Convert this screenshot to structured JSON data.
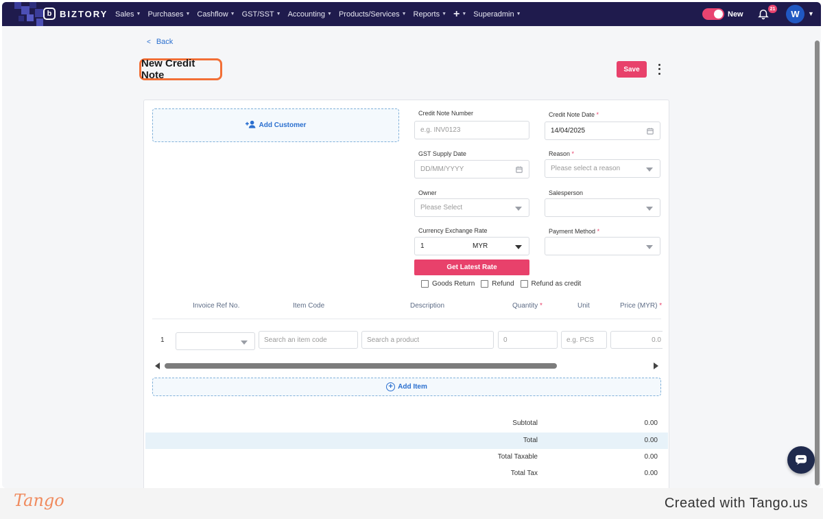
{
  "nav": {
    "brand": "BIZTORY",
    "brand_icon": "b",
    "menu": [
      {
        "label": "Sales"
      },
      {
        "label": "Purchases"
      },
      {
        "label": "Cashflow"
      },
      {
        "label": "GST/SST"
      },
      {
        "label": "Accounting"
      },
      {
        "label": "Products/Services"
      },
      {
        "label": "Reports"
      },
      {
        "label": "+"
      },
      {
        "label": "Superadmin"
      }
    ],
    "toggle_label": "New",
    "notification_count": "21",
    "avatar_initial": "W"
  },
  "page": {
    "back_label": "Back",
    "title": "New Credit Note",
    "save_label": "Save"
  },
  "customer": {
    "add_label": "Add Customer"
  },
  "form": {
    "credit_note_number": {
      "label": "Credit Note Number",
      "placeholder": "e.g. INV0123"
    },
    "credit_note_date": {
      "label": "Credit Note Date",
      "required": "*",
      "value": "14/04/2025"
    },
    "gst_supply_date": {
      "label": "GST Supply Date",
      "placeholder": "DD/MM/YYYY"
    },
    "reason": {
      "label": "Reason",
      "required": "*",
      "placeholder": "Please select a reason"
    },
    "owner": {
      "label": "Owner",
      "placeholder": "Please Select"
    },
    "salesperson": {
      "label": "Salesperson",
      "value": ""
    },
    "currency_exchange_rate": {
      "label": "Currency Exchange Rate",
      "value": "1",
      "currency": "MYR"
    },
    "payment_method": {
      "label": "Payment Method",
      "required": "*",
      "value": ""
    },
    "latest_rate_label": "Get Latest Rate",
    "checkboxes": [
      {
        "label": "Goods Return"
      },
      {
        "label": "Refund"
      },
      {
        "label": "Refund as credit"
      }
    ]
  },
  "items": {
    "columns": [
      {
        "label": "Invoice Ref No."
      },
      {
        "label": "Item Code"
      },
      {
        "label": "Description"
      },
      {
        "label": "Quantity",
        "required": "*"
      },
      {
        "label": "Unit"
      },
      {
        "label": "Price (MYR)",
        "required": "*"
      }
    ],
    "rows": [
      {
        "index": "1",
        "item_code_placeholder": "Search an item code",
        "description_placeholder": "Search a product",
        "quantity_placeholder": "0",
        "unit_placeholder": "e.g. PCS",
        "price_placeholder": "0.0"
      }
    ],
    "add_item_label": "Add Item"
  },
  "totals": [
    {
      "label": "Subtotal",
      "value": "0.00"
    },
    {
      "label": "Total",
      "value": "0.00"
    },
    {
      "label": "Total Taxable",
      "value": "0.00"
    },
    {
      "label": "Total Tax",
      "value": "0.00"
    }
  ],
  "footer": {
    "logo": "Tango",
    "created_with": "Created with Tango.us"
  },
  "colors": {
    "nav_bg": "#1f1b4d",
    "accent": "#e8416b",
    "link": "#2a6fcf",
    "highlight_border": "#f26f36"
  }
}
